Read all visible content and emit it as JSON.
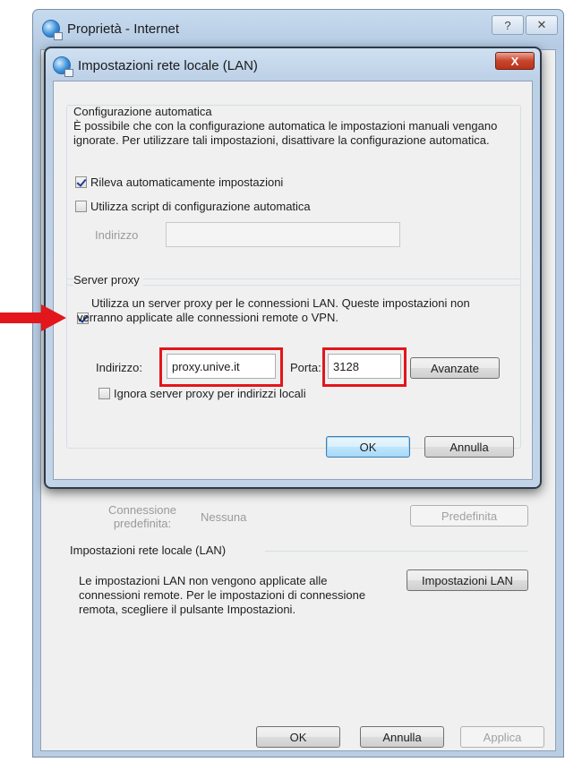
{
  "outer": {
    "title": "Proprietà - Internet",
    "help_glyph": "?",
    "close_glyph": "✕",
    "default_conn_label": "Connessione predefinita:",
    "default_conn_value": "Nessuna",
    "default_button": "Predefinita",
    "lan_group_title": "Impostazioni rete locale (LAN)",
    "lan_group_text": "Le impostazioni LAN non vengono applicate alle connessioni remote. Per le impostazioni di connessione remota, scegliere il pulsante Impostazioni.",
    "lan_settings_button": "Impostazioni LAN",
    "ok_button": "OK",
    "cancel_button": "Annulla",
    "apply_button": "Applica"
  },
  "lan_dialog": {
    "title": "Impostazioni rete locale (LAN)",
    "close_glyph": "X",
    "auto_config": {
      "legend": "Configurazione automatica",
      "description": "È possibile che con la configurazione automatica le impostazioni manuali vengano ignorate. Per utilizzare tali impostazioni, disattivare la configurazione automatica.",
      "auto_detect_label": "Rileva automaticamente impostazioni",
      "auto_detect_checked": true,
      "use_script_label": "Utilizza script di configurazione automatica",
      "use_script_checked": false,
      "address_label": "Indirizzo",
      "address_value": ""
    },
    "proxy": {
      "legend": "Server proxy",
      "use_proxy_label": "Utilizza un server proxy per le connessioni LAN. Queste impostazioni non verranno applicate alle connessioni remote o VPN.",
      "use_proxy_checked": true,
      "address_label": "Indirizzo:",
      "address_value": "proxy.unive.it",
      "port_label": "Porta:",
      "port_value": "3128",
      "advanced_button": "Avanzate",
      "bypass_label": "Ignora server proxy per indirizzi locali",
      "bypass_checked": false
    },
    "ok_button": "OK",
    "cancel_button": "Annulla"
  },
  "annotation": {
    "arrow_color": "#e2161b",
    "highlight_color": "#e2161b"
  }
}
